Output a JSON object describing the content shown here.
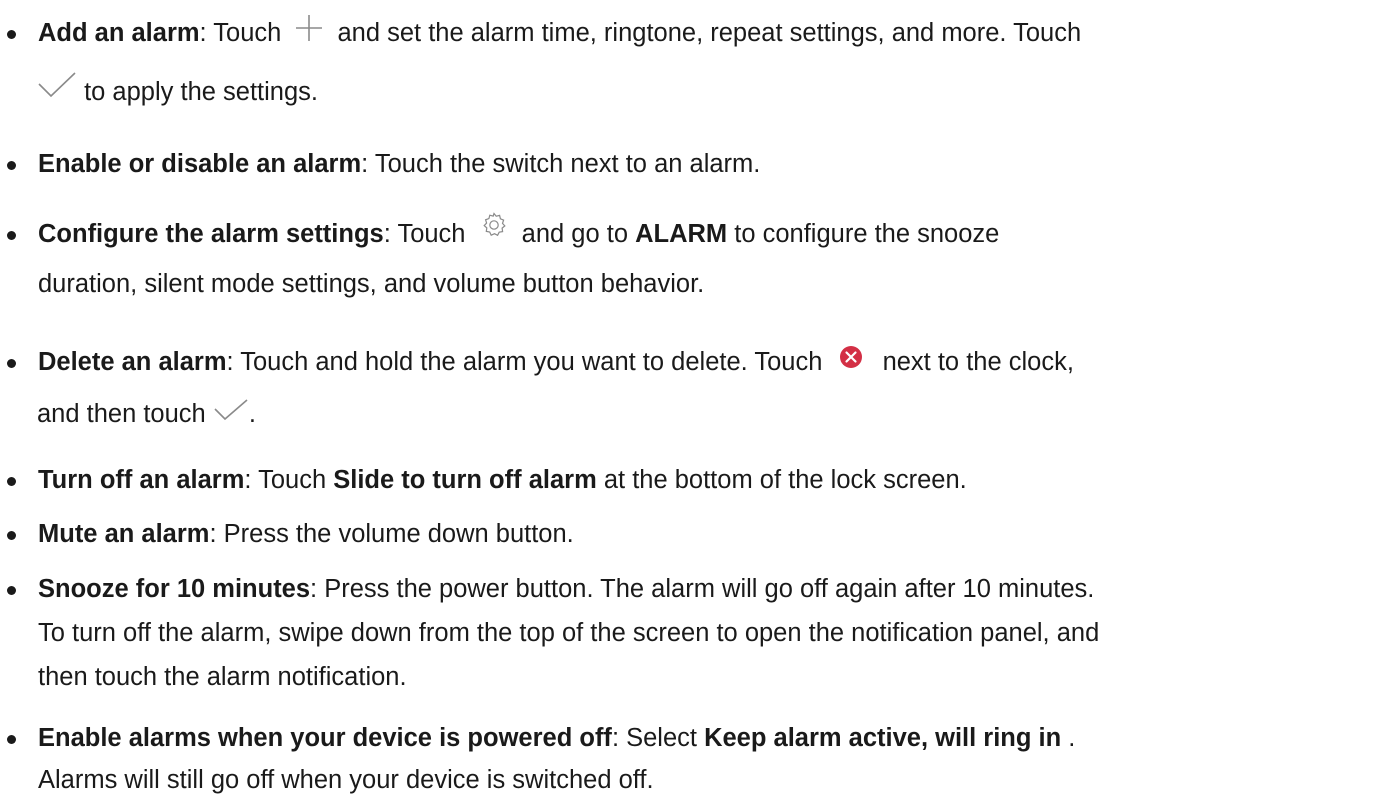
{
  "colors": {
    "text": "#1a1a1a",
    "icon_stroke": "#8a8a8a",
    "delete_red": "#d32f45"
  },
  "icons": {
    "add": "plus-icon",
    "apply": "checkmark-icon",
    "settings": "gear-icon",
    "delete": "delete-circle-icon"
  },
  "items": [
    {
      "title": "Add an alarm",
      "t1": ": Touch ",
      "t2": " and set the alarm time, ringtone, repeat settings, and more. Touch",
      "t3": " to apply the settings."
    },
    {
      "title": "Enable or disable an alarm",
      "t1": ": Touch the switch next to an alarm."
    },
    {
      "title": "Configure the alarm settings",
      "t1": ": Touch ",
      "t2": " and go to ",
      "bold2": "ALARM",
      "t3": " to configure the snooze",
      "t4": "duration, silent mode settings, and volume button behavior."
    },
    {
      "title": "Delete an alarm",
      "t1": ": Touch and hold the alarm you want to delete. Touch ",
      "t2": " next to the clock,",
      "t3": "and then touch ",
      "t4": "."
    },
    {
      "title": "Turn off an alarm",
      "t1": ": Touch ",
      "bold2": "Slide to turn off alarm",
      "t2": " at the bottom of the lock screen."
    },
    {
      "title": "Mute an alarm",
      "t1": ": Press the volume down button."
    },
    {
      "title": "Snooze for 10 minutes",
      "t1": ": Press the power button. The alarm will go off again after 10 minutes.",
      "t2": "To turn off the alarm, swipe down from the top of the screen to open the notification panel, and",
      "t3": "then touch the alarm notification."
    },
    {
      "title": "Enable alarms when your device is powered off",
      "t1": ": Select ",
      "bold2": "Keep alarm active, will ring in",
      "t2": " .",
      "t3": "Alarms will still go off when your device is switched off."
    }
  ]
}
